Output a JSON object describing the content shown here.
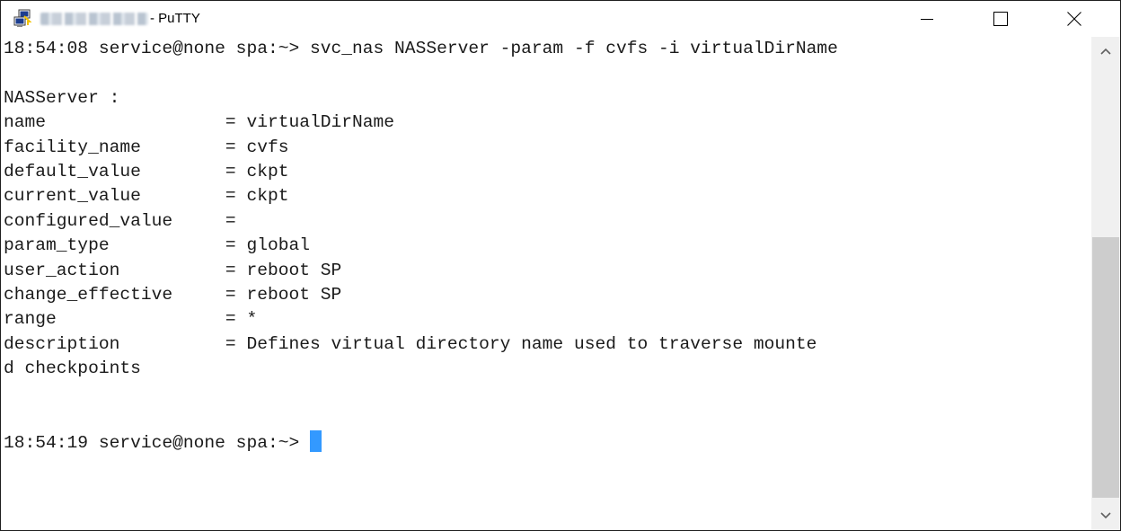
{
  "window": {
    "title_suffix": "- PuTTY"
  },
  "icons": {
    "app": "putty-icon",
    "minimize": "minimize-icon",
    "maximize": "maximize-icon",
    "close": "close-icon",
    "scroll_up": "chevron-up-icon",
    "scroll_down": "chevron-down-icon"
  },
  "terminal": {
    "lines": [
      "18:54:08 service@none spa:~> svc_nas NASServer -param -f cvfs -i virtualDirName",
      "",
      "NASServer :",
      "name                 = virtualDirName",
      "facility_name        = cvfs",
      "default_value        = ckpt",
      "current_value        = ckpt",
      "configured_value     =",
      "param_type           = global",
      "user_action          = reboot SP",
      "change_effective     = reboot SP",
      "range                = *",
      "description          = Defines virtual directory name used to traverse mounte",
      "d checkpoints",
      "",
      "",
      "18:54:19 service@none spa:~> "
    ]
  },
  "colors": {
    "cursor": "#3399ff",
    "text": "#1a1a1a",
    "background": "#ffffff",
    "scroll_thumb": "#cdcdcd"
  }
}
